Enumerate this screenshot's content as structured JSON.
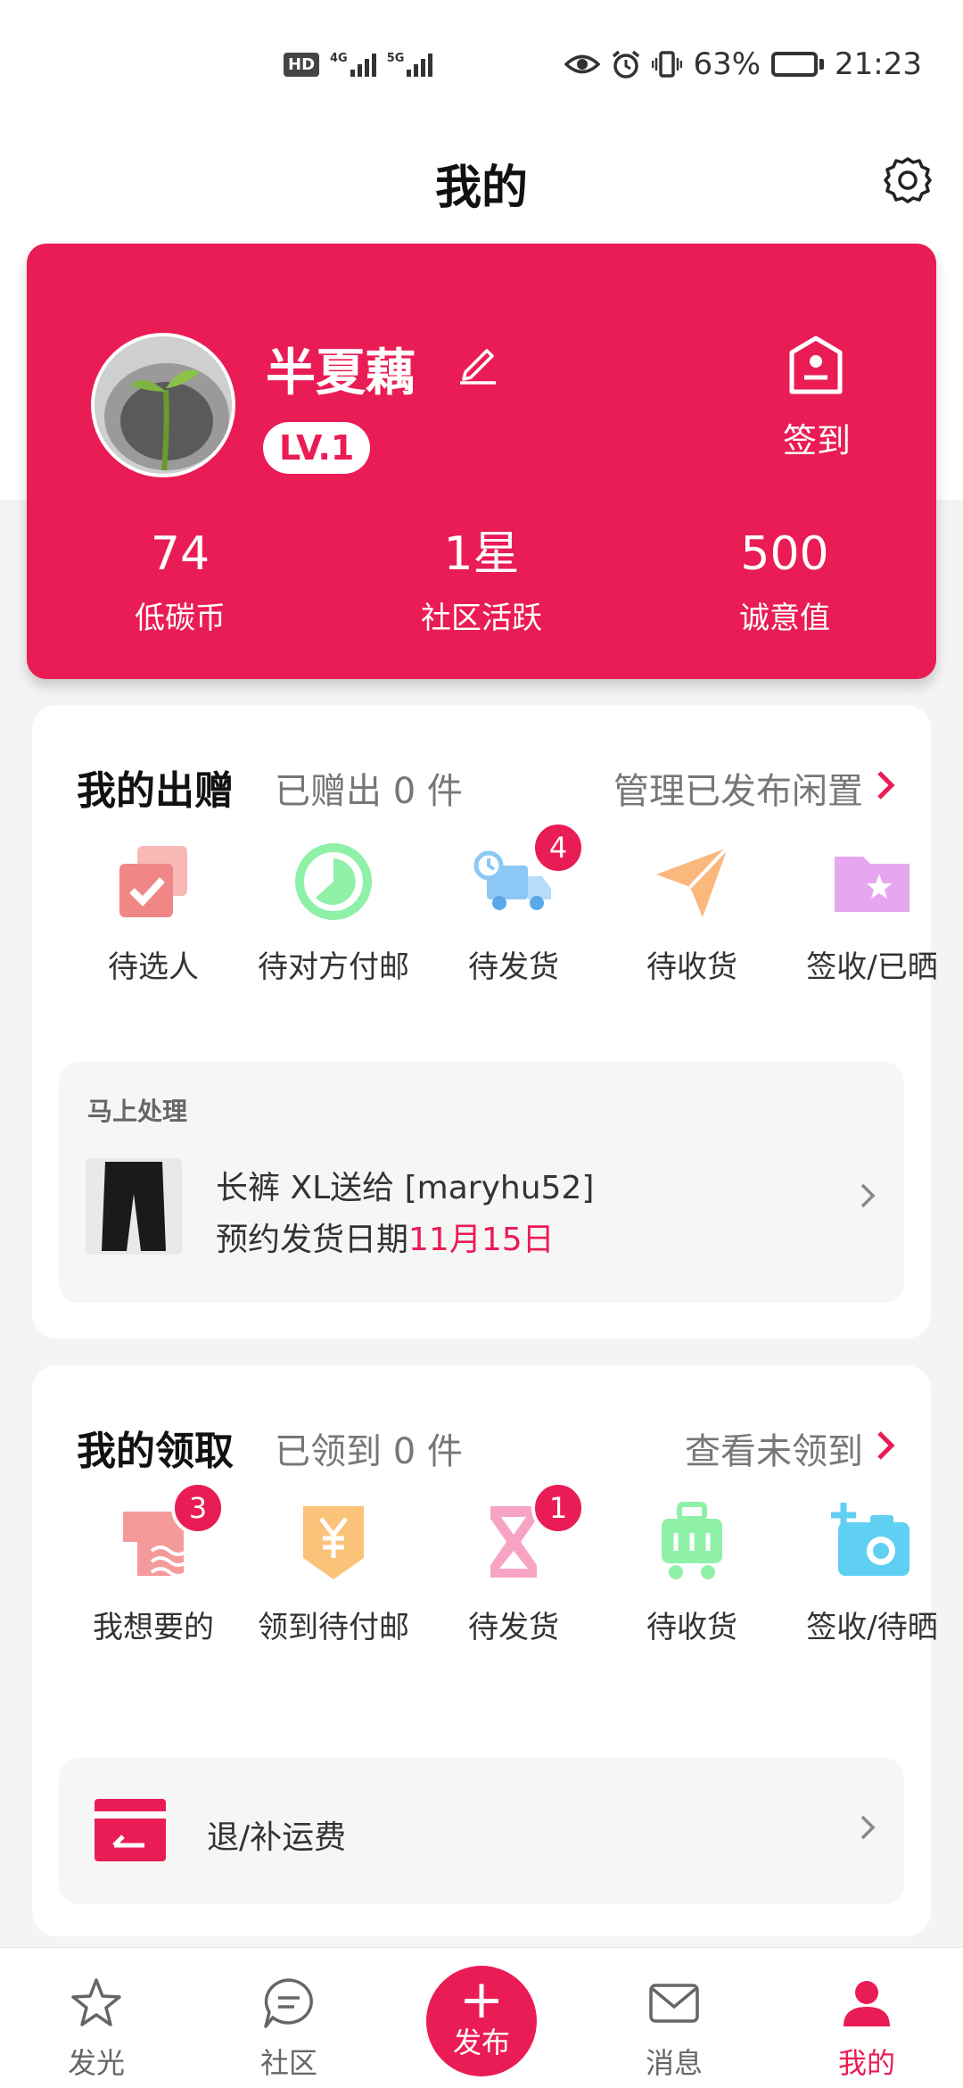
{
  "status_bar": {
    "hd_label": "HD",
    "net1": "4G",
    "net2": "5G",
    "battery_pct": "63%",
    "battery_level": 0.63,
    "time": "21:23"
  },
  "header": {
    "title": "我的"
  },
  "profile": {
    "name": "半夏藕",
    "level": "LV.1",
    "checkin_label": "签到",
    "stats": [
      {
        "value": "74",
        "label": "低碳币"
      },
      {
        "value": "1星",
        "label": "社区活跃"
      },
      {
        "value": "500",
        "label": "诚意值"
      }
    ]
  },
  "giving": {
    "title": "我的出赠",
    "summary": "已赠出 0 件",
    "manage_link": "管理已发布闲置",
    "items": [
      {
        "label": "待选人",
        "icon": "check-square-icon",
        "badge": ""
      },
      {
        "label": "待对方付邮",
        "icon": "clock-circle-icon",
        "badge": ""
      },
      {
        "label": "待发货",
        "icon": "truck-icon",
        "badge": "4"
      },
      {
        "label": "待收货",
        "icon": "paper-plane-icon",
        "badge": ""
      },
      {
        "label": "签收/已晒",
        "icon": "star-folder-icon",
        "badge": ""
      }
    ],
    "todo": {
      "title": "马上处理",
      "line1": "长裤 XL送给 [maryhu52]",
      "line2_prefix": "预约发货日期",
      "line2_date": "11月15日"
    }
  },
  "receiving": {
    "title": "我的领取",
    "summary": "已领到 0 件",
    "view_link": "查看未领到",
    "items": [
      {
        "label": "我想要的",
        "icon": "shirt-icon",
        "badge": "3"
      },
      {
        "label": "领到待付邮",
        "icon": "yen-shield-icon",
        "badge": ""
      },
      {
        "label": "待发货",
        "icon": "hourglass-icon",
        "badge": "1"
      },
      {
        "label": "待收货",
        "icon": "cart-icon",
        "badge": ""
      },
      {
        "label": "签收/待晒",
        "icon": "camera-plus-icon",
        "badge": ""
      }
    ],
    "refund_label": "退/补运费"
  },
  "bottom_nav": [
    {
      "label": "发光",
      "icon": "star-icon"
    },
    {
      "label": "社区",
      "icon": "chat-bubble-icon"
    },
    {
      "label": "发布",
      "icon": "plus-icon"
    },
    {
      "label": "消息",
      "icon": "mail-icon"
    },
    {
      "label": "我的",
      "icon": "person-icon"
    }
  ],
  "colors": {
    "accent": "#ea1c55",
    "background": "#f4f4f4"
  }
}
